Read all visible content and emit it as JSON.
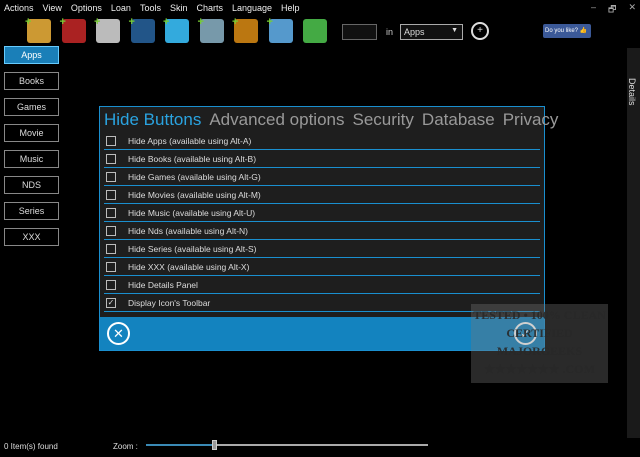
{
  "menu": [
    "Actions",
    "View",
    "Options",
    "Loan",
    "Tools",
    "Skin",
    "Charts",
    "Language",
    "Help"
  ],
  "window_buttons": [
    "–",
    "🗗",
    "✕"
  ],
  "toolbar": {
    "tools": [
      {
        "name": "tools-icon",
        "color": "#c93"
      },
      {
        "name": "book-icon",
        "color": "#a22"
      },
      {
        "name": "gamepad-icon",
        "color": "#bbb"
      },
      {
        "name": "movie-icon",
        "color": "#258"
      },
      {
        "name": "music-icon",
        "color": "#3ad"
      },
      {
        "name": "nds-icon",
        "color": "#79a"
      },
      {
        "name": "tv-icon",
        "color": "#b71"
      },
      {
        "name": "xxx-folder-icon",
        "color": "#59c"
      },
      {
        "name": "download-icon",
        "color": "#4a4"
      }
    ],
    "search_value": "",
    "in_label": "in",
    "category": "Apps",
    "like_label": "Do you like?"
  },
  "sidebar": [
    "Apps",
    "Books",
    "Games",
    "Movie",
    "Music",
    "NDS",
    "Series",
    "XXX"
  ],
  "details_label": "Details",
  "dialog": {
    "tabs": [
      "Hide Buttons",
      "Advanced options",
      "Security",
      "Database",
      "Privacy"
    ],
    "options": [
      {
        "label": "Hide Apps (available using Alt-A)",
        "checked": false
      },
      {
        "label": "Hide Books (available using Alt-B)",
        "checked": false
      },
      {
        "label": "Hide Games (available using Alt-G)",
        "checked": false
      },
      {
        "label": "Hide Movies (available using Alt-M)",
        "checked": false
      },
      {
        "label": "Hide Music (available using Alt-U)",
        "checked": false
      },
      {
        "label": "Hide Nds (available using Alt-N)",
        "checked": false
      },
      {
        "label": "Hide Series (available using Alt-S)",
        "checked": false
      },
      {
        "label": "Hide XXX (available using Alt-X)",
        "checked": false
      },
      {
        "label": "Hide Details Panel",
        "checked": false
      },
      {
        "label": "Display Icon's Toolbar",
        "checked": true
      }
    ]
  },
  "watermark": [
    "TESTED • 100% CLEAN",
    "CERTIFIED",
    "MAJORGEEKS",
    "★★★★★★★ .COM"
  ],
  "status": "0 Item(s) found",
  "zoom": {
    "label": "Zoom :",
    "value_fraction": 0.24
  }
}
